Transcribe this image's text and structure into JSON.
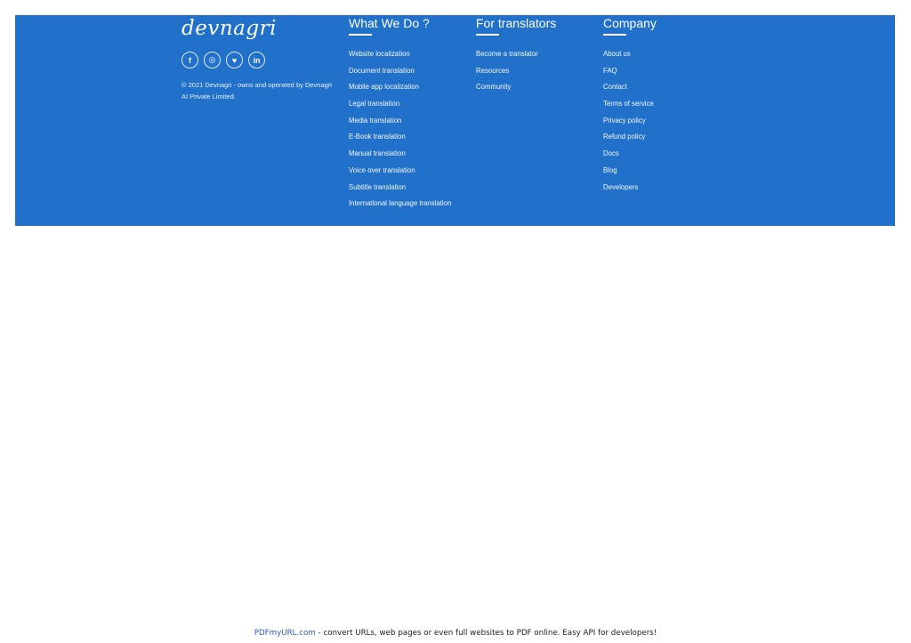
{
  "brand": {
    "logo_text": "devnagri",
    "copyright": "© 2021 Devnagri - owns and operated by Devnagri AI Private Limited."
  },
  "social": [
    {
      "icon": "facebook-icon",
      "glyph": "f"
    },
    {
      "icon": "instagram-icon",
      "glyph": "◎"
    },
    {
      "icon": "twitter-icon",
      "glyph": "♥"
    },
    {
      "icon": "linkedin-icon",
      "glyph": "in"
    }
  ],
  "what_we_do": {
    "title": "What We Do ?",
    "items": [
      "Website localization",
      "Document translation",
      "Mobile app localization",
      "Legal translation",
      "Media translation",
      "E-Book translation",
      "Manual translation",
      "Voice over translation",
      "Subtitle translation",
      "International language translation"
    ]
  },
  "for_translators": {
    "title": "For translators",
    "items": [
      "Become a translator",
      "Resources",
      "Community"
    ]
  },
  "company": {
    "title": "Company",
    "items": [
      "About us",
      "FAQ",
      "Contact",
      "Terms of service",
      "Privacy policy",
      "Refund policy",
      "Docs",
      "Blog",
      "Developers"
    ]
  },
  "pdf_footer": {
    "link": "PDFmyURL.com",
    "text": " - convert URLs, web pages or even full websites to PDF online. Easy API for developers!"
  },
  "colors": {
    "footer_bg": "#2170c9",
    "link_blue": "#2a58c7"
  }
}
